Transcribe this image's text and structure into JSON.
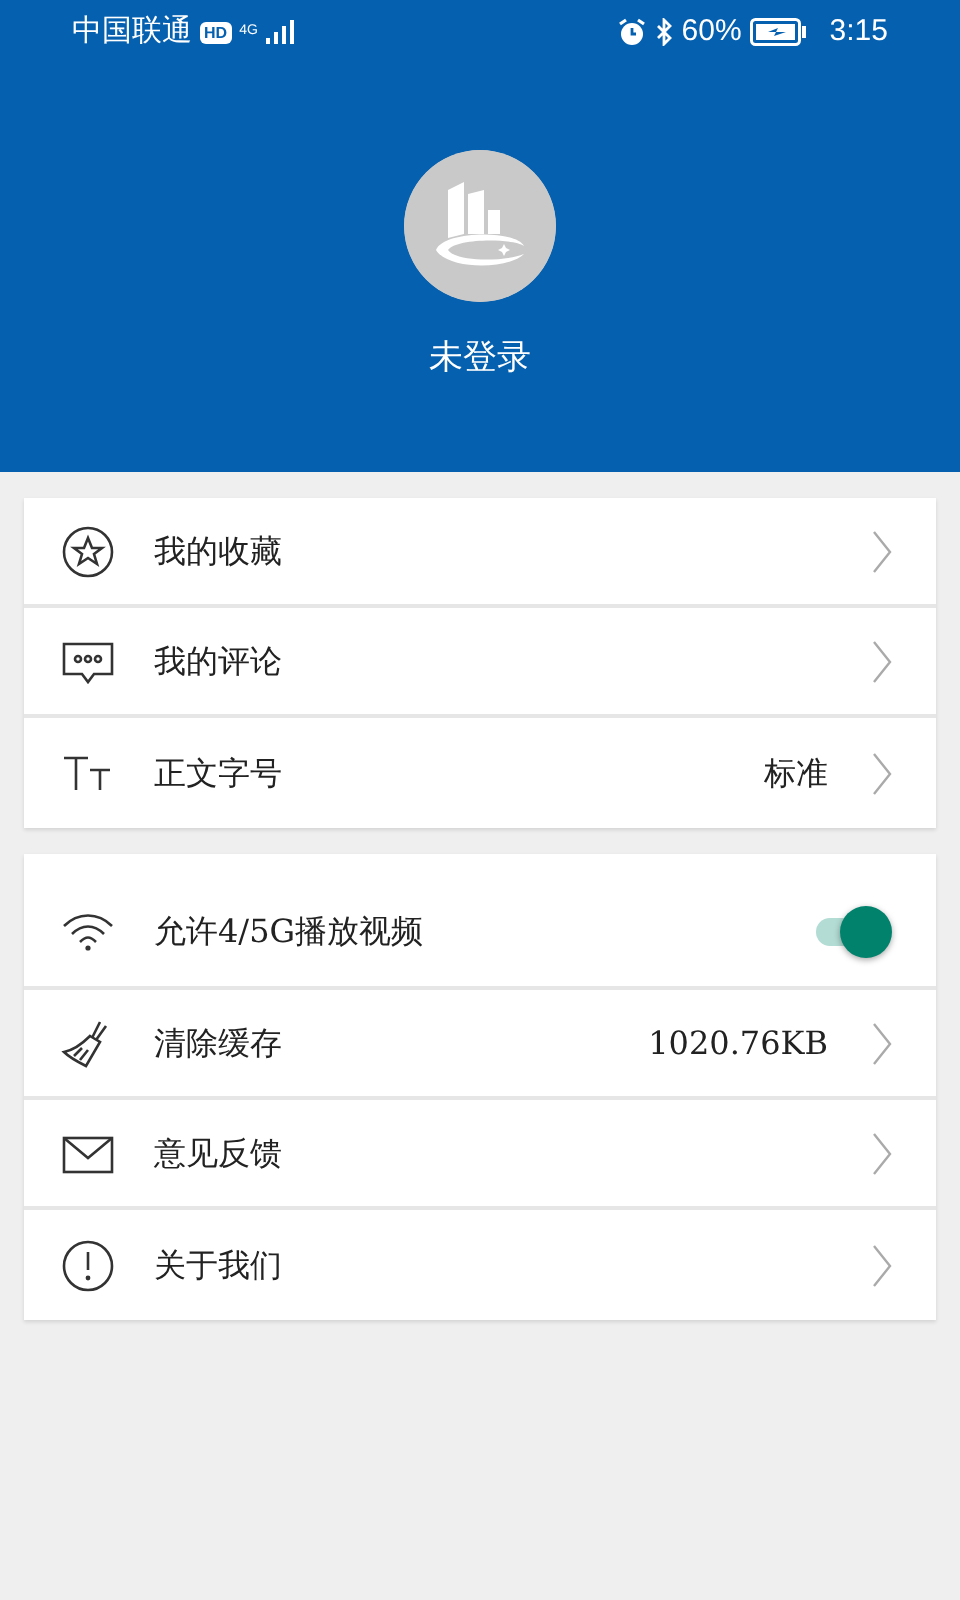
{
  "status_bar": {
    "carrier": "中国联通",
    "hd_badge": "HD",
    "network": "4G",
    "battery_percent": "60%",
    "time": "3:15"
  },
  "profile": {
    "name": "未登录"
  },
  "groups": [
    {
      "rows": [
        {
          "kind": "link",
          "label": "我的收藏"
        },
        {
          "kind": "link",
          "label": "我的评论"
        },
        {
          "kind": "link",
          "label": "正文字号",
          "value": "标准"
        }
      ]
    },
    {
      "rows": [
        {
          "kind": "toggle",
          "label": "允许4/5G播放视频",
          "on": true
        },
        {
          "kind": "link",
          "label": "清除缓存",
          "value": "1020.76KB"
        },
        {
          "kind": "link",
          "label": "意见反馈"
        },
        {
          "kind": "link",
          "label": "关于我们"
        }
      ]
    }
  ]
}
